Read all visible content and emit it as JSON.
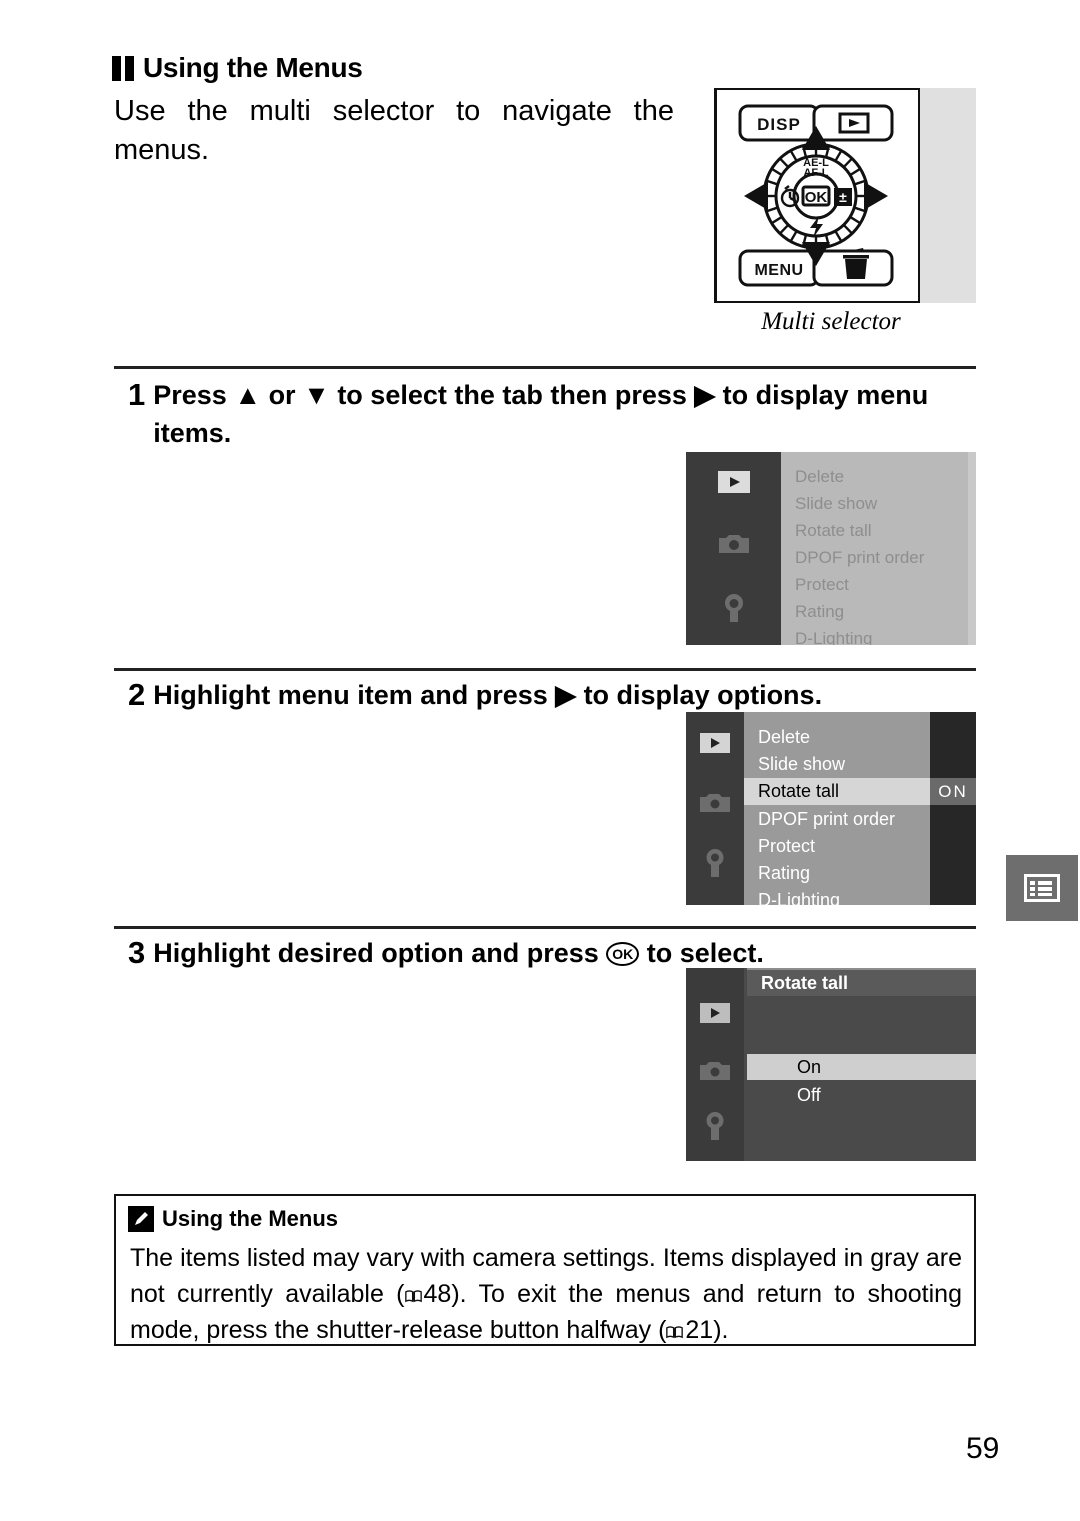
{
  "page": {
    "number": "59"
  },
  "heading": {
    "icon": "two-bars-icon",
    "title": "Using the Menus"
  },
  "intro": {
    "text": "Use the multi selector to navigate the menus."
  },
  "figure": {
    "caption": "Multi selector",
    "buttons": {
      "disp": "DISP",
      "playback": "playback-icon",
      "menu": "MENU",
      "delete": "trash-icon",
      "ok": "OK",
      "ae_af_lock": "AE-L\nAF-L",
      "self_timer": "self-timer-icon",
      "exposure_comp": "exposure-compensation-icon",
      "flash": "flash-icon"
    }
  },
  "steps": [
    {
      "number": "1",
      "text_before_up": "Press ",
      "up": "▲",
      "text_mid1": " or ",
      "down": "▼",
      "text_mid2": " to select the tab then press ",
      "right": "▶",
      "text_after": " to display menu items."
    },
    {
      "number": "2",
      "text_before": "Highlight menu item and press ",
      "right": "▶",
      "text_after": " to display options."
    },
    {
      "number": "3",
      "text_before": "Highlight desired option and press ",
      "ok": "OK",
      "text_after": " to select."
    }
  ],
  "lcd1": {
    "state": "grayed",
    "sidebar_icons": [
      "playback-icon",
      "camera-icon",
      "wrench-icon"
    ],
    "items": [
      "Delete",
      "Slide show",
      "Rotate tall",
      "DPOF print order",
      "Protect",
      "Rating",
      "D-Lighting"
    ]
  },
  "lcd2": {
    "state": "active",
    "sidebar_icons": [
      "playback-icon",
      "camera-icon",
      "wrench-icon"
    ],
    "items": [
      "Delete",
      "Slide show",
      "Rotate tall",
      "DPOF print order",
      "Protect",
      "Rating",
      "D-Lighting"
    ],
    "selected_index": 2,
    "selected_value": "ON"
  },
  "lcd3": {
    "title": "Rotate tall",
    "sidebar_icons": [
      "playback-icon",
      "camera-icon",
      "wrench-icon"
    ],
    "options": [
      "On",
      "Off"
    ],
    "selected_index": 0
  },
  "side_tab": {
    "icon": "menu-list-icon"
  },
  "note": {
    "icon": "pencil-icon",
    "title": "Using the Menus",
    "line1": "The items listed may vary with camera settings. Items displayed in gray are not currently available (",
    "ref1": "48",
    "line2": "). To exit the menus and return to shooting mode, press the shutter-release button halfway (",
    "ref2": "21",
    "line3": ")."
  },
  "colors": {
    "lcd_dark_sidebar": "#3b3b3b",
    "lcd1_background": "#b9b9b9",
    "lcd1_text": "#8e8e8e",
    "lcd2_background": "#9a9a9a",
    "lcd2_highlight": "#d6d6d6",
    "lcd2_right_column": "#272727",
    "lcd3_background": "#4a4a4a",
    "lcd3_highlight": "#cfcfcf",
    "side_tab": "#6e6e6e"
  }
}
